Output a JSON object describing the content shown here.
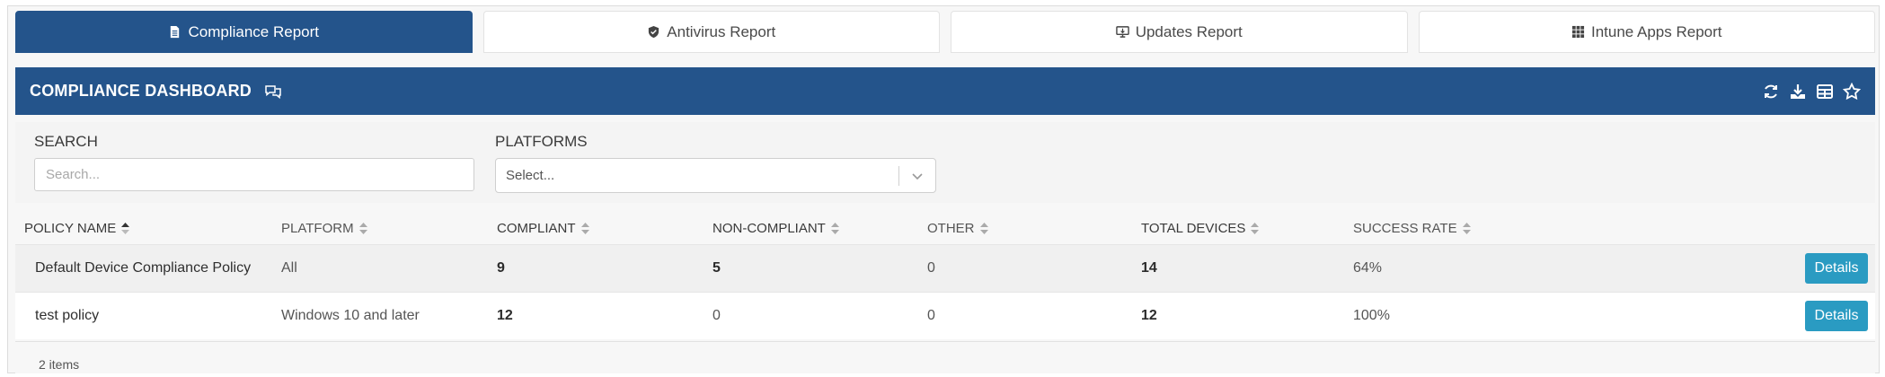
{
  "tabs": [
    {
      "label": "Compliance Report",
      "icon": "file-text-icon",
      "active": true
    },
    {
      "label": "Antivirus Report",
      "icon": "shield-check-icon",
      "active": false
    },
    {
      "label": "Updates Report",
      "icon": "monitor-download-icon",
      "active": false
    },
    {
      "label": "Intune Apps Report",
      "icon": "grid-icon",
      "active": false
    }
  ],
  "header": {
    "title": "COMPLIANCE DASHBOARD",
    "icons": [
      "chat-icon",
      "refresh-icon",
      "download-icon",
      "table-columns-icon",
      "star-icon"
    ],
    "color": "#24548b"
  },
  "filters": {
    "search_label": "SEARCH",
    "search_placeholder": "Search...",
    "platforms_label": "PLATFORMS",
    "platforms_placeholder": "Select..."
  },
  "table": {
    "columns": [
      "POLICY NAME",
      "PLATFORM",
      "COMPLIANT",
      "NON-COMPLIANT",
      "OTHER",
      "TOTAL DEVICES",
      "SUCCESS RATE"
    ],
    "sorted_column": "POLICY NAME",
    "rows": [
      {
        "policy_name": "Default Device Compliance Policy",
        "platform": "All",
        "compliant": "9",
        "non_compliant": "5",
        "other": "0",
        "total_devices": "14",
        "success_rate": "64%",
        "action": "Details"
      },
      {
        "policy_name": "test policy",
        "platform": "Windows 10 and later",
        "compliant": "12",
        "non_compliant": "0",
        "other": "0",
        "total_devices": "12",
        "success_rate": "100%",
        "action": "Details"
      }
    ]
  },
  "footer": {
    "item_count": "2 items"
  },
  "colors": {
    "primary": "#24548b",
    "button": "#2a9bc2"
  }
}
